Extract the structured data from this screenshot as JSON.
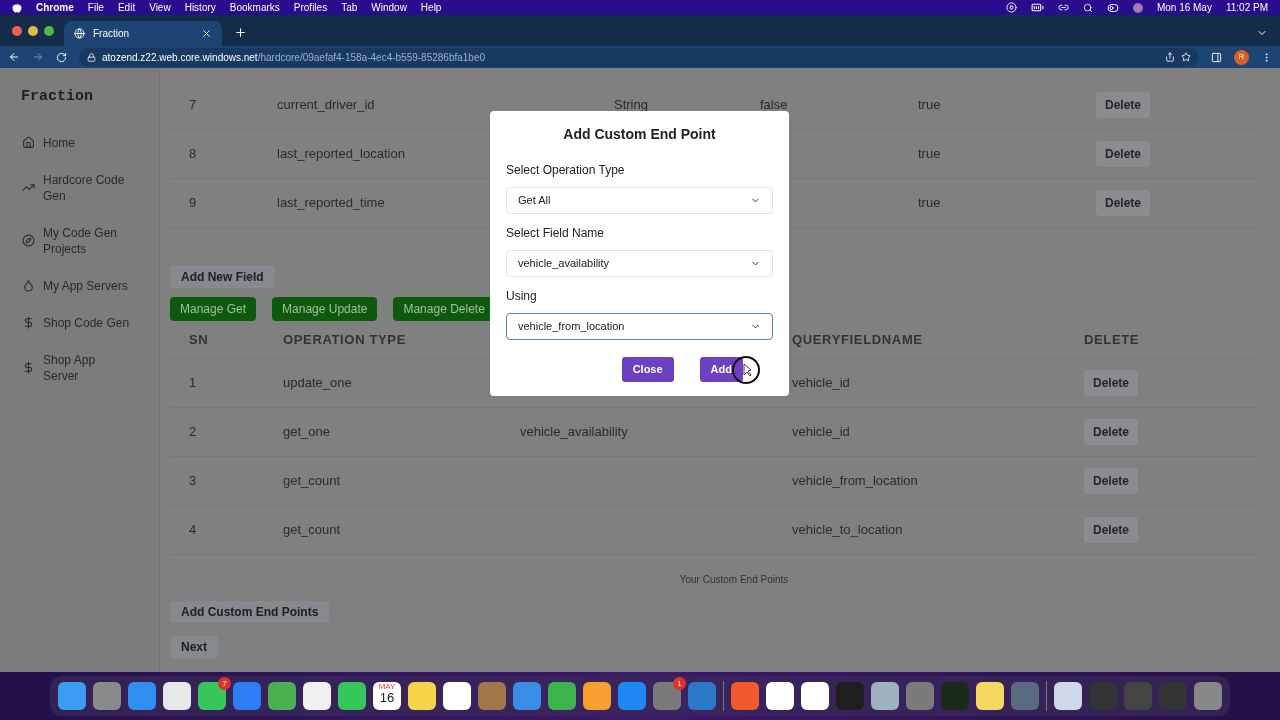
{
  "menu_bar": {
    "app": "Chrome",
    "items": [
      "File",
      "Edit",
      "View",
      "History",
      "Bookmarks",
      "Profiles",
      "Tab",
      "Window",
      "Help"
    ],
    "date": "Mon 16 May",
    "time": "11:02 PM"
  },
  "browser": {
    "tab_title": "Fraction",
    "url_host": "atozend.z22.web.core.windows.net",
    "url_path": "/hardcore/09aefaf4-158a-4ec4-b559-85286bfa1be0",
    "profile_initial": "R"
  },
  "sidebar": {
    "brand": "Fraction",
    "items": [
      {
        "label": "Home"
      },
      {
        "label": "Hardcore Code Gen"
      },
      {
        "label": "My Code Gen Projects"
      },
      {
        "label": "My App Servers"
      },
      {
        "label": "Shop Code Gen"
      },
      {
        "label": "Shop App Server"
      }
    ]
  },
  "fields_table": {
    "rows": [
      {
        "sn": "7",
        "name": "current_driver_id",
        "type": "String",
        "column_4": "false",
        "column_5": "true",
        "action": "Delete"
      },
      {
        "sn": "8",
        "name": "last_reported_location",
        "column_5": "true",
        "action": "Delete"
      },
      {
        "sn": "9",
        "name": "last_reported_time",
        "column_5": "true",
        "action": "Delete"
      }
    ]
  },
  "add_field_button": "Add New Field",
  "manage_buttons": [
    "Manage Get",
    "Manage Update",
    "Manage Delete"
  ],
  "endpoints_table": {
    "headers": {
      "sn": "SN",
      "operation_type": "OPERATION TYPE",
      "query_field_name": "QUERYFIELDNAME",
      "delete": "DELETE"
    },
    "rows": [
      {
        "sn": "1",
        "operation_type": "update_one",
        "query_field_name": "vehicle_id",
        "action": "Delete"
      },
      {
        "sn": "2",
        "operation_type": "get_one",
        "column_3": "vehicle_availability",
        "query_field_name": "vehicle_id",
        "action": "Delete"
      },
      {
        "sn": "3",
        "operation_type": "get_count",
        "query_field_name": "vehicle_from_location",
        "action": "Delete"
      },
      {
        "sn": "4",
        "operation_type": "get_count",
        "query_field_name": "vehicle_to_location",
        "action": "Delete"
      }
    ],
    "caption": "Your Custom End Points"
  },
  "add_endpoints_button": "Add Custom End Points",
  "next_button": "Next",
  "modal": {
    "title": "Add Custom End Point",
    "fields": [
      {
        "label": "Select Operation Type",
        "value": "Get All",
        "focused": false
      },
      {
        "label": "Select Field Name",
        "value": "vehicle_availability",
        "focused": false
      },
      {
        "label": "Using",
        "value": "vehicle_from_location",
        "focused": true
      }
    ],
    "buttons": [
      "Close",
      "Add"
    ]
  },
  "dock": {
    "calendar_month": "MAY",
    "calendar_day": "16",
    "badges": [
      {
        "count": "7"
      },
      {
        "count": "1"
      }
    ]
  }
}
